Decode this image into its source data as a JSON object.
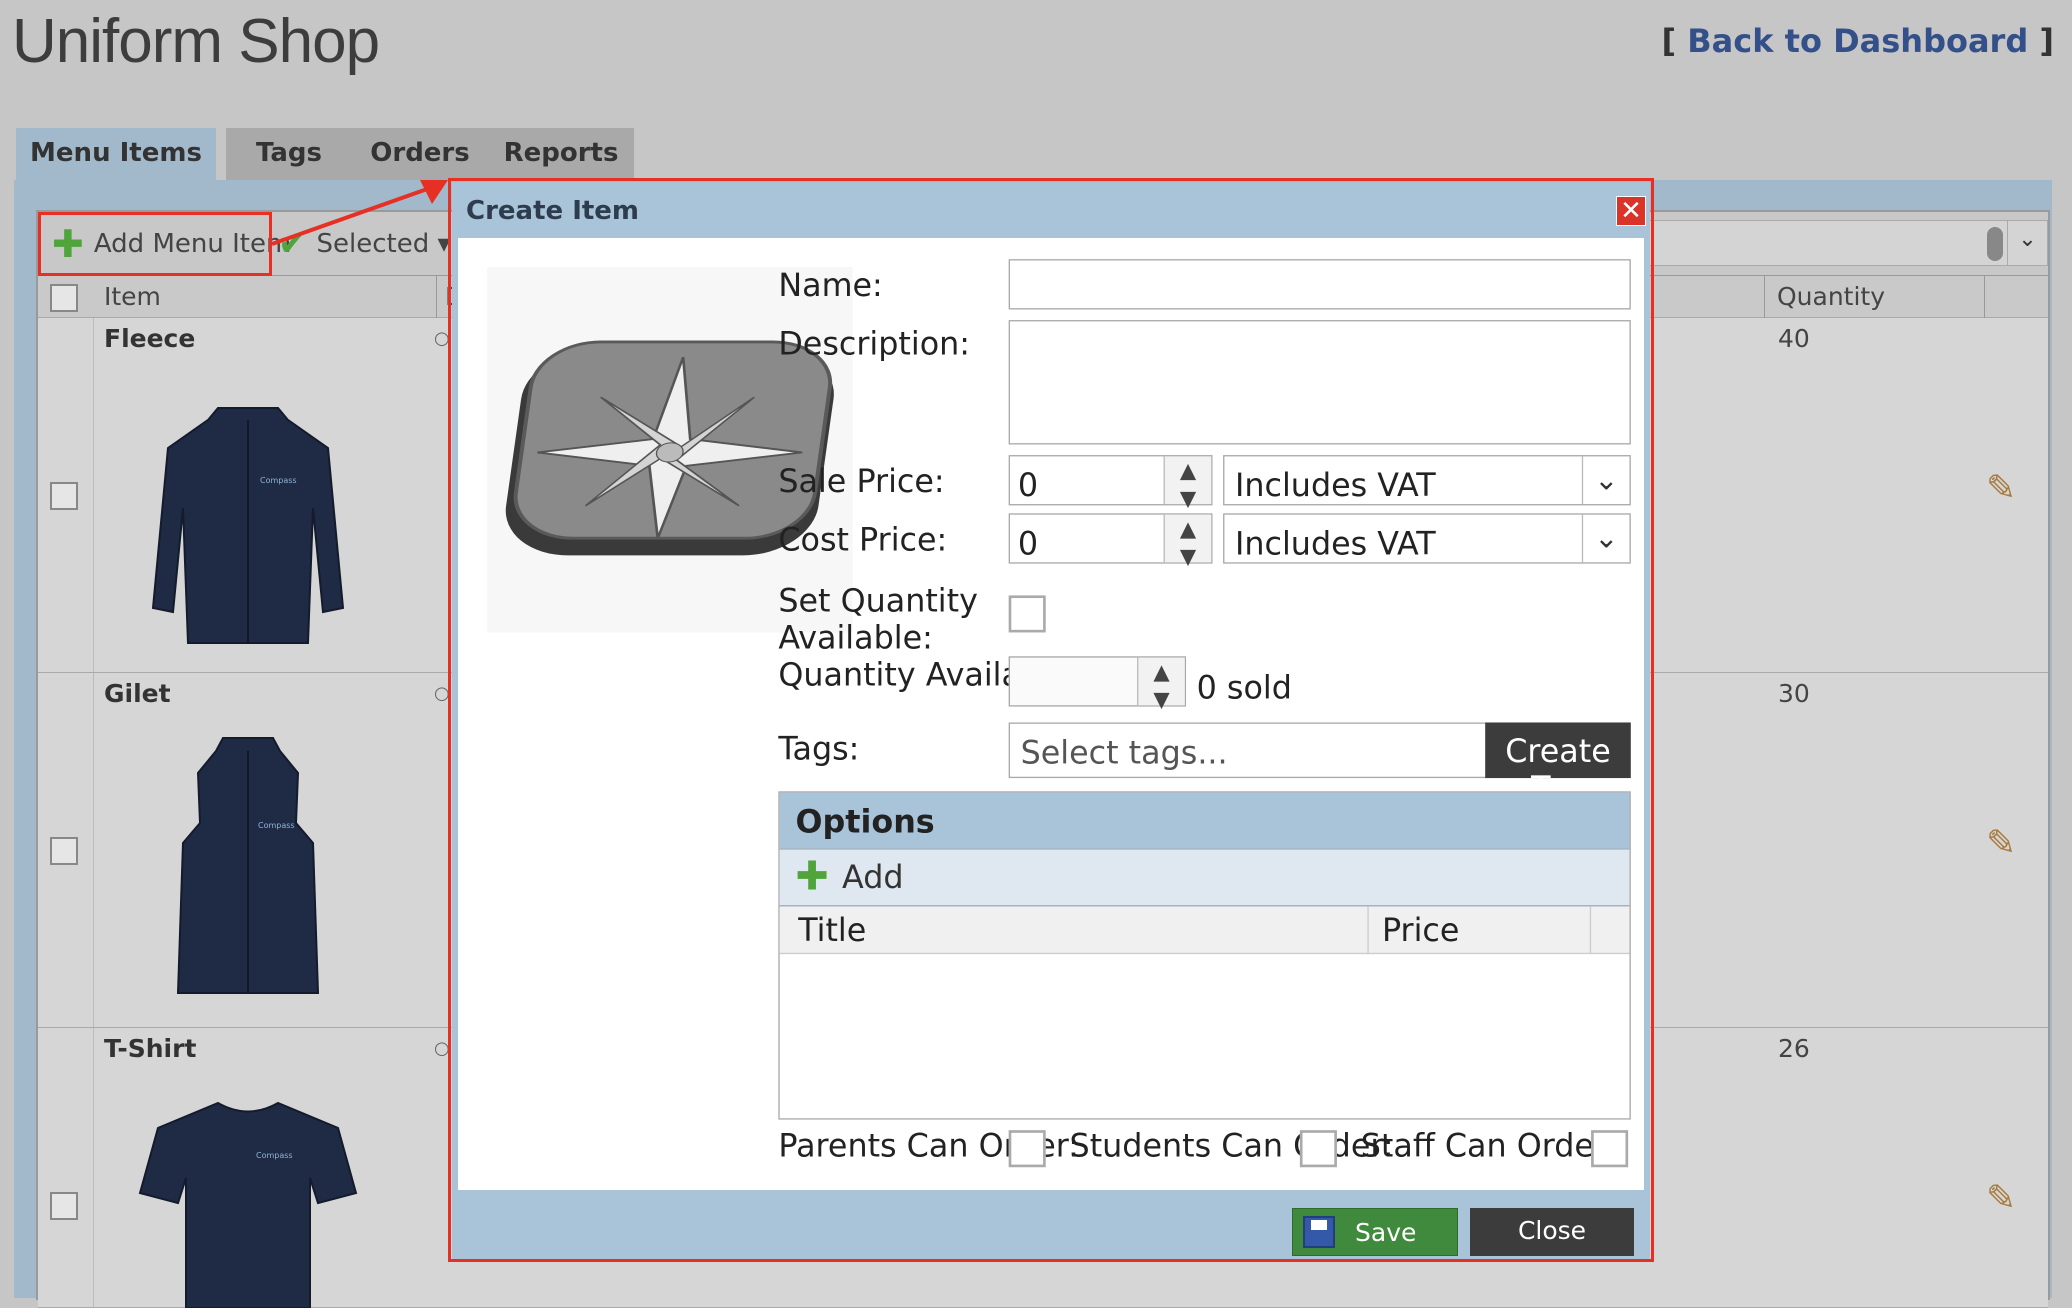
{
  "page": {
    "title": "Uniform Shop",
    "back_link_prefix": "[",
    "back_link": "Back to Dashboard",
    "back_link_suffix": "]"
  },
  "tabs": [
    {
      "label": "Menu Items",
      "active": true
    },
    {
      "label": "Tags"
    },
    {
      "label": "Orders"
    },
    {
      "label": "Reports"
    }
  ],
  "toolbar": {
    "add_label": "Add Menu Item",
    "selected_label": "Selected ▾"
  },
  "table": {
    "columns": [
      "Item",
      "D",
      "Quantity"
    ],
    "rows": [
      {
        "name": "Fleece",
        "quantity": "40"
      },
      {
        "name": "Gilet",
        "quantity": "30"
      },
      {
        "name": "T-Shirt",
        "quantity": "26"
      }
    ]
  },
  "modal": {
    "title": "Create Item",
    "close_glyph": "✕",
    "labels": {
      "name": "Name:",
      "description": "Description:",
      "sale_price": "Sale Price:",
      "cost_price": "Cost Price:",
      "set_quantity_line1": "Set Quantity",
      "set_quantity_line2": "Available:",
      "quantity_available": "Quantity Available:",
      "tags": "Tags:"
    },
    "values": {
      "name": "",
      "description": "",
      "sale_price": "0",
      "sale_vat": "Includes VAT",
      "cost_price": "0",
      "cost_vat": "Includes VAT",
      "quantity_available": "",
      "sold": "0 sold"
    },
    "placeholders": {
      "tags": "Select tags..."
    },
    "create_tag_label": "Create Tag",
    "options": {
      "title": "Options",
      "add_label": "Add",
      "columns": [
        "Title",
        "Price"
      ]
    },
    "permissions": {
      "parents": "Parents Can Order:",
      "students": "Students Can Order:",
      "staff": "Staff Can Order:"
    },
    "save_label": "Save",
    "close_label": "Close"
  },
  "icons": {
    "plus": "plus-icon",
    "check": "check-icon",
    "pencil": "pencil-icon",
    "floppy": "floppy-disk-icon",
    "compass": "compass-star-icon"
  },
  "colors": {
    "highlight_red": "#e53023",
    "modal_header": "#a9c3d8",
    "save_green": "#3f8a3d",
    "link_blue": "#34508a"
  }
}
